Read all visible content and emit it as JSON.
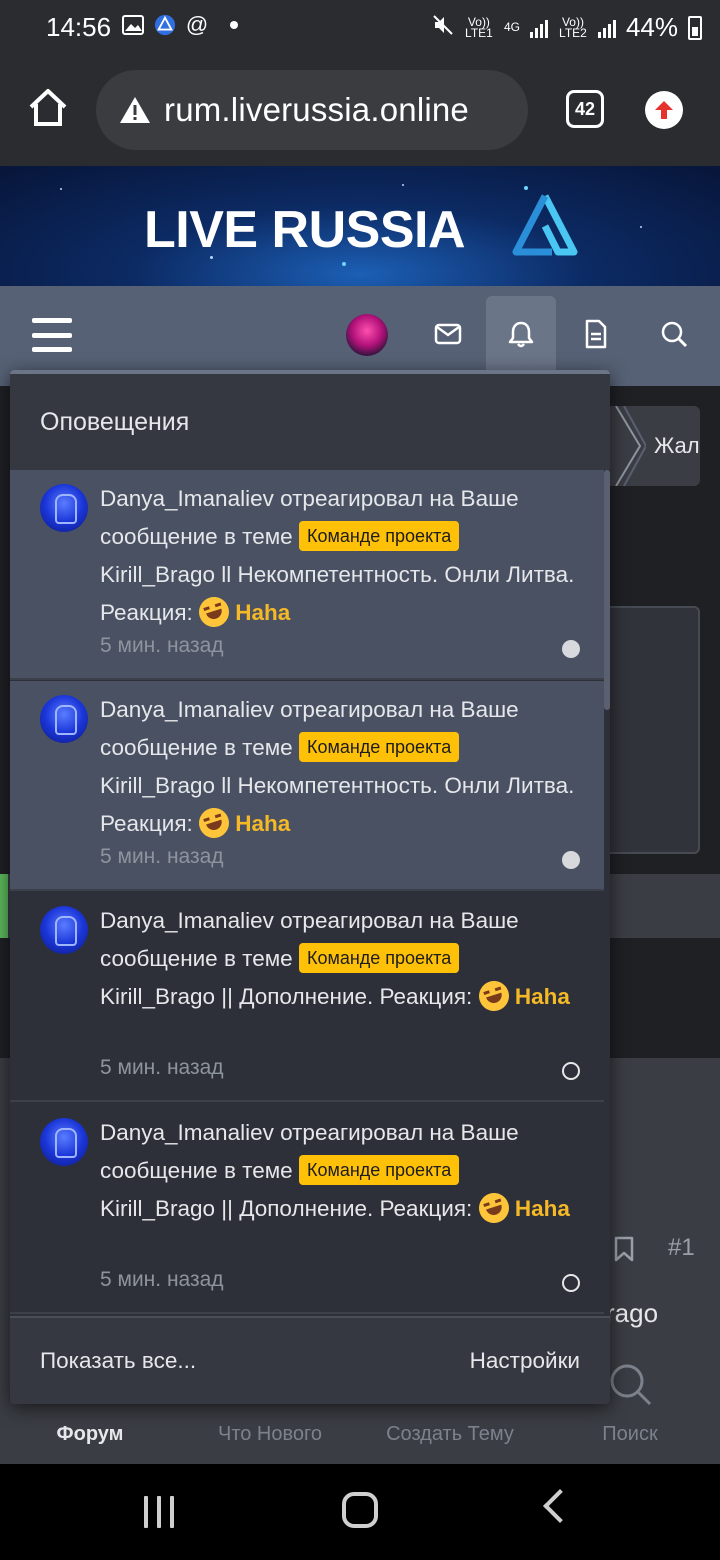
{
  "status_bar": {
    "time": "14:56",
    "lte1": "Vo)) LTE1",
    "network": "4G",
    "lte2": "Vo)) LTE2",
    "battery": "44%"
  },
  "browser": {
    "url": "rum.liverussia.online",
    "tab_count": "42"
  },
  "banner": {
    "brand": "LIVE RUSSIA"
  },
  "background": {
    "breadcrumb_text": "Жал",
    "post_number": "#1",
    "post_author_fragment": "rago"
  },
  "notifications": {
    "title": "Оповещения",
    "badge_label": "Команде проекта",
    "items": [
      {
        "user": "Danya_Imanaliev",
        "action": " отреагировал на Ваше сообщение в теме ",
        "topic": " Kirill_Brago ll Некомпетентность. Онли Литва. Реакция: ",
        "reaction": "Haha",
        "time": "5 мин. назад",
        "status": "unread"
      },
      {
        "user": "Danya_Imanaliev",
        "action": " отреагировал на Ваше сообщение в теме ",
        "topic": " Kirill_Brago ll Некомпетентность. Онли Литва. Реакция: ",
        "reaction": "Haha",
        "time": "5 мин. назад",
        "status": "unread"
      },
      {
        "user": "Danya_Imanaliev",
        "action": " отреагировал на Ваше сообщение в теме ",
        "topic": " Kirill_Brago || Дополнение. Реакция: ",
        "reaction": "Haha",
        "time": "5 мин. назад",
        "status": "read"
      },
      {
        "user": "Danya_Imanaliev",
        "action": " отреагировал на Ваше сообщение в теме ",
        "topic": " Kirill_Brago || Дополнение. Реакция: ",
        "reaction": "Haha",
        "time": "5 мин. назад",
        "status": "read"
      }
    ],
    "show_all": "Показать все...",
    "settings": "Настройки"
  },
  "bottom_tabs": [
    "Форум",
    "Что Нового",
    "Создать Тему",
    "Поиск"
  ],
  "colors": {
    "accent_badge": "#ffc107",
    "reaction": "#f5b928",
    "nav_bg": "#566175"
  }
}
